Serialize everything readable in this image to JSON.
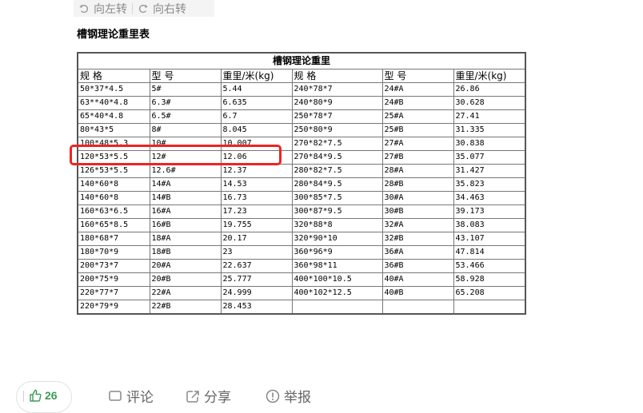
{
  "toolbar": {
    "rotate_left": "向左转",
    "rotate_right": "向右转"
  },
  "document": {
    "title": "槽钢理论重里表"
  },
  "table": {
    "caption": "槽钢理论重里",
    "headers": [
      "规 格",
      "型 号",
      "重里/米(kg)",
      "规 格",
      "型 号",
      "重里/米(kg)"
    ],
    "rows": [
      [
        "50*37*4.5",
        "5#",
        "5.44",
        "240*78*7",
        "24#A",
        "26.86"
      ],
      [
        "63**40*4.8",
        "6.3#",
        "6.635",
        "240*80*9",
        "24#B",
        "30.628"
      ],
      [
        "65*40*4.8",
        "6.5#",
        "6.7",
        "250*78*7",
        "25#A",
        "27.41"
      ],
      [
        "80*43*5",
        "8#",
        "8.045",
        "250*80*9",
        "25#B",
        "31.335"
      ],
      [
        "100*48*5.3",
        "10#",
        "10.007",
        "270*82*7.5",
        "27#A",
        "30.838"
      ],
      [
        "120*53*5.5",
        "12#",
        "12.06",
        "270*84*9.5",
        "27#B",
        "35.077"
      ],
      [
        "126*53*5.5",
        "12.6#",
        "12.37",
        "280*82*7.5",
        "28#A",
        "31.427"
      ],
      [
        "140*60*8",
        "14#A",
        "14.53",
        "280*84*9.5",
        "28#B",
        "35.823"
      ],
      [
        "140*60*8",
        "14#B",
        "16.73",
        "300*85*7.5",
        "30#A",
        "34.463"
      ],
      [
        "160*63*6.5",
        "16#A",
        "17.23",
        "300*87*9.5",
        "30#B",
        "39.173"
      ],
      [
        "160*65*8.5",
        "16#B",
        "19.755",
        "320*88*8",
        "32#A",
        "38.083"
      ],
      [
        "180*68*7",
        "18#A",
        "20.17",
        "320*90*10",
        "32#B",
        "43.107"
      ],
      [
        "180*70*9",
        "18#B",
        "23",
        "360*96*9",
        "36#A",
        "47.814"
      ],
      [
        "200*73*7",
        "20#A",
        "22.637",
        "360*98*11",
        "36#B",
        "53.466"
      ],
      [
        "200*75*9",
        "20#B",
        "25.777",
        "400*100*10.5",
        "40#A",
        "58.928"
      ],
      [
        "220*77*7",
        "22#A",
        "24.999",
        "400*102*12.5",
        "40#B",
        "65.208"
      ],
      [
        "220*79*9",
        "22#B",
        "28.453",
        "",
        "",
        ""
      ]
    ]
  },
  "actions": {
    "like_count": "26",
    "comment_label": "评论",
    "share_label": "分享",
    "report_label": "举报"
  },
  "colors": {
    "highlight": "#ee2424",
    "like_green": "#3d9a55"
  }
}
